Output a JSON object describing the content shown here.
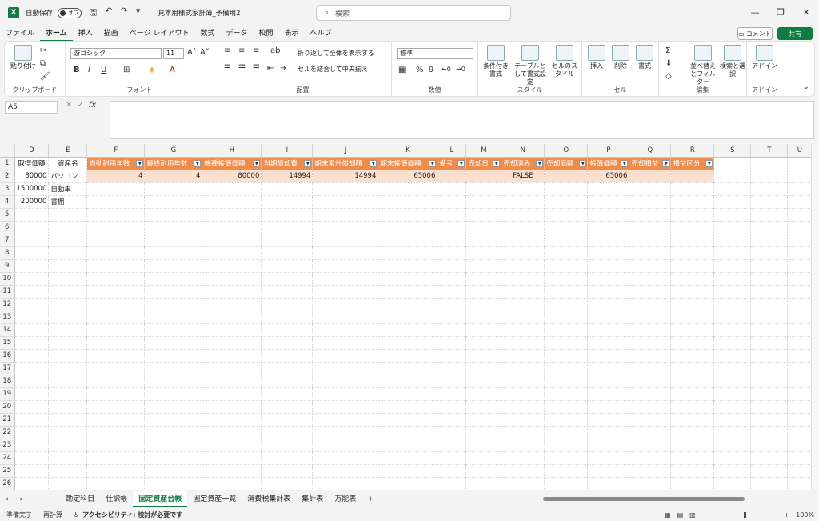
{
  "titlebar": {
    "autosave_label": "自動保存",
    "autosave_state": "オフ",
    "doc_title": "見本用様式家計簿_予備用2",
    "search_placeholder": "検索"
  },
  "menu": [
    "ファイル",
    "ホーム",
    "挿入",
    "描画",
    "ページ レイアウト",
    "数式",
    "データ",
    "校閲",
    "表示",
    "ヘルプ"
  ],
  "menu_active": "ホーム",
  "comment_label": "コメント",
  "share_label": "共有",
  "ribbon": {
    "paste": "貼り付け",
    "clipboard": "クリップボード",
    "font_name": "游ゴシック",
    "font_size": "11",
    "font_group": "フォント",
    "wrap_text": "折り返して全体を表示する",
    "merge_center": "セルを結合して中央揃え",
    "align_group": "配置",
    "number_format": "標準",
    "number_group": "数値",
    "cond_format": "条件付き書式",
    "table_format": "テーブルとして書式設定",
    "cell_style": "セルのスタイル",
    "style_group": "スタイル",
    "insert": "挿入",
    "delete": "削除",
    "format": "書式",
    "cells_group": "セル",
    "sort_filter": "並べ替えとフィルター",
    "find_select": "検索と選択",
    "edit_group": "編集",
    "addin": "アドイン",
    "addin_group": "アドイン"
  },
  "namebox": "A5",
  "columns": [
    "D",
    "E",
    "F",
    "G",
    "H",
    "I",
    "J",
    "K",
    "L",
    "M",
    "N",
    "O",
    "P",
    "Q",
    "R",
    "S",
    "T",
    "U"
  ],
  "headers": [
    "取得価額",
    "資産名",
    "自動耐用年数",
    "最終耐用年数",
    "機種帳簿価額",
    "当期償却費",
    "期末累計償却額",
    "期末帳簿価額",
    "備考",
    "売却日",
    "売却済み",
    "売却価額",
    "帳簿価額",
    "売却損益",
    "損益区分"
  ],
  "rows": [
    [
      "80000",
      "パソコン",
      "4",
      "4",
      "80000",
      "14994",
      "14994",
      "65006",
      "",
      "",
      "FALSE",
      "",
      "65006",
      "",
      ""
    ],
    [
      "1500000",
      "自動車",
      "",
      "",
      "",
      "",
      "",
      "",
      "",
      "",
      "",
      "",
      "",
      "",
      ""
    ],
    [
      "200000",
      "書棚",
      "",
      "",
      "",
      "",
      "",
      "",
      "",
      "",
      "",
      "",
      "",
      "",
      ""
    ]
  ],
  "row_count": 26,
  "sheets": [
    "勘定科目",
    "仕訳帳",
    "固定資産台帳",
    "固定資産一覧",
    "消費税集計表",
    "集計表",
    "万能表"
  ],
  "active_sheet": "固定資産台帳",
  "status": {
    "ready": "準備完了",
    "recalc": "再計算",
    "accessibility": "アクセシビリティ: 検討が必要です",
    "zoom": "100%"
  }
}
